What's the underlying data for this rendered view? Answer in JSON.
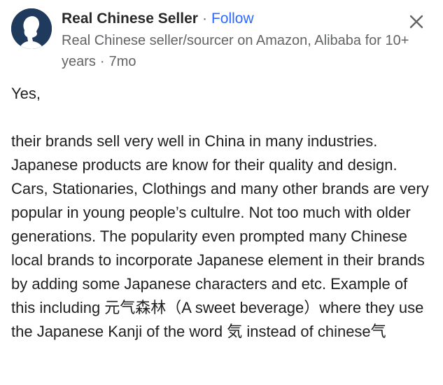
{
  "header": {
    "author_name": "Real Chinese Seller",
    "separator": "·",
    "follow_label": "Follow",
    "credential": "Real Chinese seller/sourcer on Amazon, Alibaba for 10+ years",
    "timestamp": "7mo",
    "avatar_icon": "person-silhouette-icon",
    "close_icon": "close-icon"
  },
  "answer": {
    "paragraphs": [
      "Yes,",
      "their brands sell very well in China in many industries. Japanese products are know for their quality and design. Cars, Stationaries, Clothings and many other brands are very popular in young people’s cultulre. Not too much with older generations. The popularity even prompted many Chinese local brands to incorporate Japanese element in their brands by adding some Japanese characters and etc. Example of this including 元气森林（A sweet beverage）where they use the Japanese Kanji of the word 気 instead of chinese气"
    ]
  },
  "colors": {
    "link": "#2e69ff",
    "muted_text": "#636466",
    "body_text": "#1f1f1f",
    "avatar_bg": "#1f3a5c"
  }
}
